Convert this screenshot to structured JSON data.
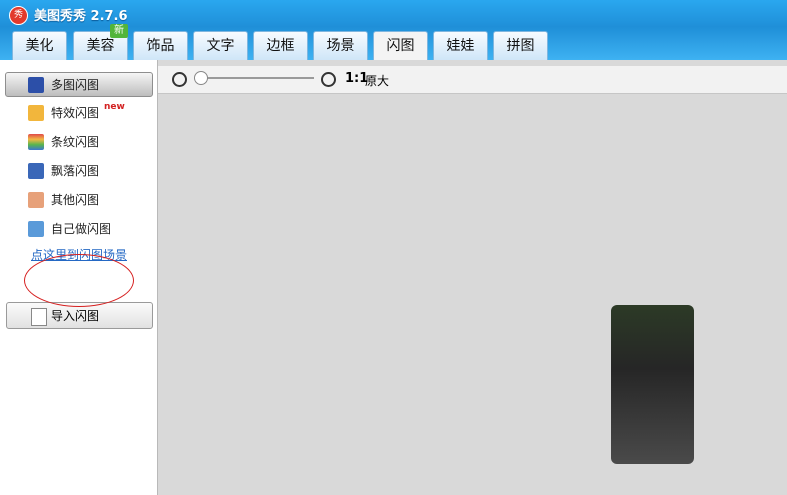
{
  "window": {
    "title": "美图秀秀 2.7.6",
    "icon": "秀"
  },
  "tabs": [
    "美化",
    "美容",
    "饰品",
    "文字",
    "边框",
    "场景",
    "闪图",
    "娃娃",
    "拼图"
  ],
  "badge": "新",
  "sidebar": {
    "items": [
      "多图闪图",
      "特效闪图",
      "条纹闪图",
      "飘落闪图",
      "其他闪图",
      "自己做闪图"
    ],
    "new_tag": "new",
    "link": "点这里到闪图场景",
    "import_label": "导入闪图"
  },
  "toolbar": {
    "zoom_ratio": "1:1",
    "zoom_label": "原大"
  },
  "colors": {
    "accent": "#1f8fd8",
    "link": "#2468c4",
    "annotation": "#d62020"
  }
}
